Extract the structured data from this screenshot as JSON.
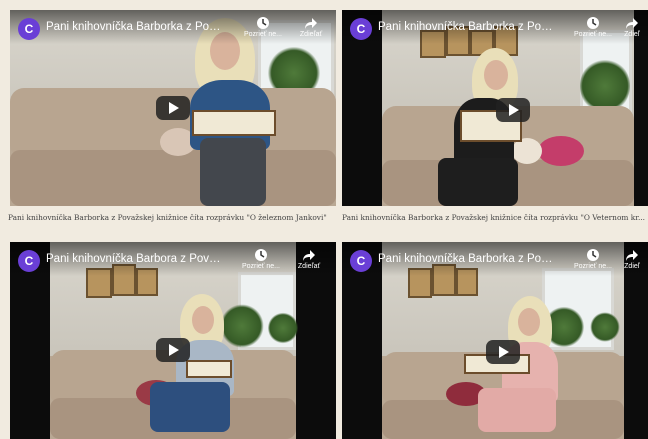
{
  "videos": [
    {
      "avatar_letter": "C",
      "title": "Pani knihovníčka Barborka z Považsk...",
      "watch_later": "Pozrieť ne...",
      "share": "Zdieľať",
      "caption": "Pani knihovníčka Barborka z Považskej knižnice číta rozprávku \"O železnom Jankovi\""
    },
    {
      "avatar_letter": "C",
      "title": "Pani knihovníčka Barborka z Považsk...",
      "watch_later": "Pozrieť ne...",
      "share": "Zdieľ",
      "caption": "Pani knihovníčka Barborka z Považskej knižnice číta rozprávku \"O Veternom kr..."
    },
    {
      "avatar_letter": "C",
      "title": "Pani knihovníčka Barbora z Považskej...",
      "watch_later": "Pozrieť ne...",
      "share": "Zdieľať",
      "caption": ""
    },
    {
      "avatar_letter": "C",
      "title": "Pani knihovníčka Barborka z Považsk...",
      "watch_later": "Pozrieť ne...",
      "share": "Zdieľ",
      "caption": ""
    }
  ]
}
